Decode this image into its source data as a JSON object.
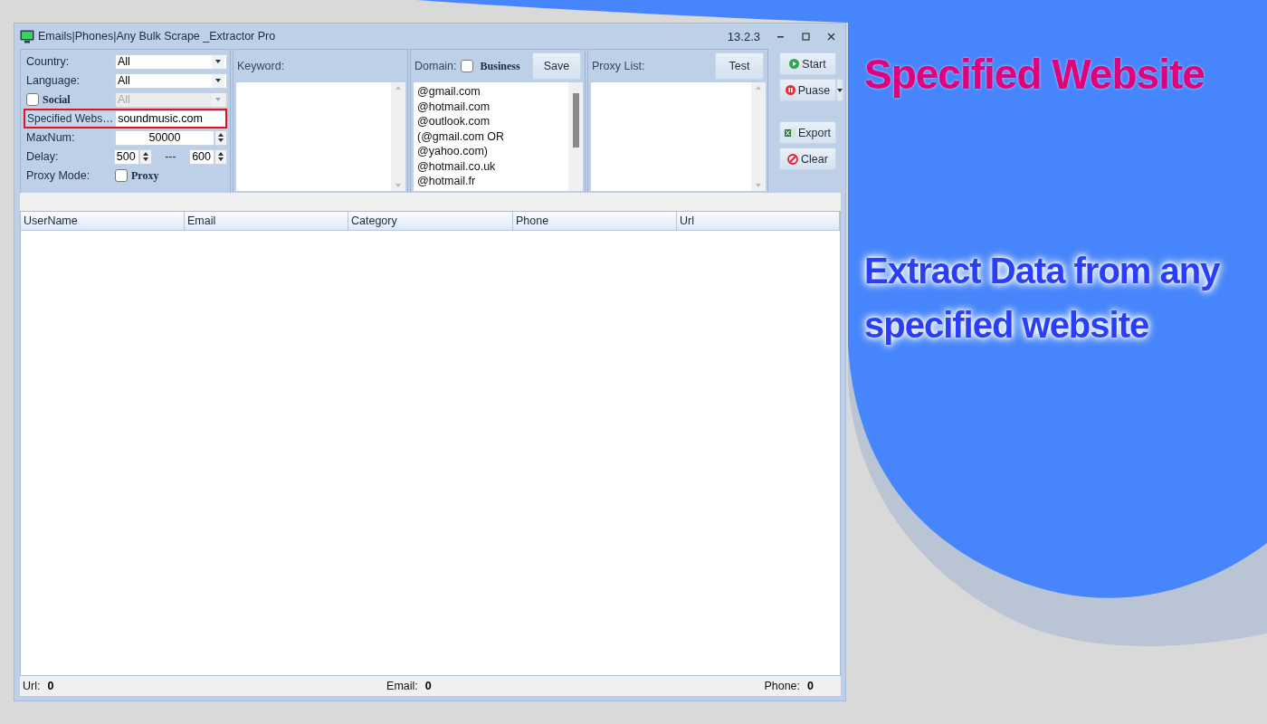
{
  "window": {
    "title": "Emails|Phones|Any Bulk Scrape _Extractor Pro",
    "version": "13.2.3"
  },
  "settings": [
    {
      "kind": "select",
      "label": "Country:",
      "value": "All"
    },
    {
      "kind": "select",
      "label": "Language:",
      "value": "All"
    },
    {
      "kind": "check-select",
      "label": "Social",
      "checked": false,
      "value": "All",
      "disabled": true
    },
    {
      "kind": "text",
      "label": "Specified Webs…",
      "value": "soundmusic.com",
      "highlighted": true
    },
    {
      "kind": "spin",
      "label": "MaxNum:",
      "value": "50000"
    },
    {
      "kind": "range",
      "label": "Delay:",
      "from": "500",
      "separator": "---",
      "to": "600"
    },
    {
      "kind": "check",
      "label": "Proxy Mode:",
      "check_label": "Proxy",
      "checked": false
    }
  ],
  "keyword": {
    "label": "Keyword:"
  },
  "domain": {
    "label": "Domain:",
    "business": {
      "label": "Business",
      "checked": false
    },
    "button": "Save",
    "items": [
      "@gmail.com",
      "@hotmail.com",
      "@outlook.com",
      "(@gmail.com OR",
      "@yahoo.com)",
      "@hotmail.co.uk",
      "@hotmail.fr"
    ]
  },
  "proxy": {
    "label": "Proxy List:",
    "button": "Test"
  },
  "actions": [
    {
      "kind": "start",
      "label": "Start"
    },
    {
      "kind": "pause",
      "label": "Puase"
    },
    {
      "kind": "export",
      "label": "Export"
    },
    {
      "kind": "clear",
      "label": "Clear"
    }
  ],
  "table": {
    "columns": [
      "UserName",
      "Email",
      "Category",
      "Phone",
      "Url"
    ]
  },
  "status_bar": [
    {
      "label": "Url:",
      "value": "0"
    },
    {
      "label": "Email:",
      "value": "0"
    },
    {
      "label": "Phone:",
      "value": "0"
    }
  ],
  "promo": {
    "headline": "Specified Website",
    "subtitle": "Extract Data from any specified website"
  }
}
